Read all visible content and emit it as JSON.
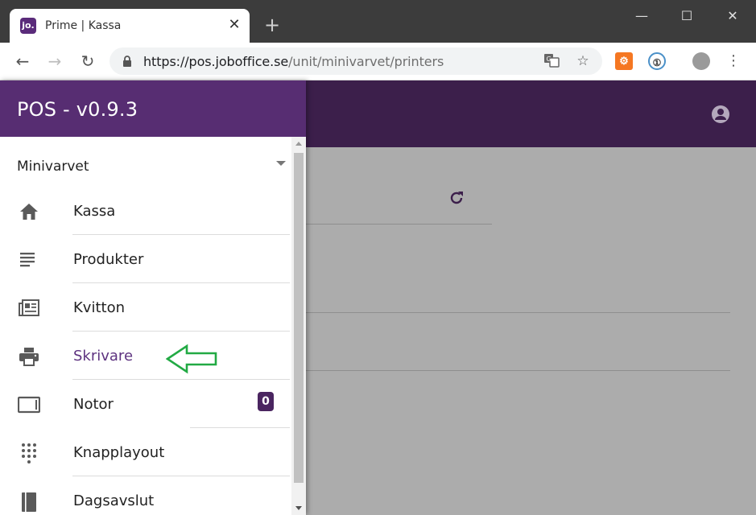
{
  "browser": {
    "tab_title": "Prime | Kassa",
    "favicon_text": "jo.",
    "url_host": "https://pos.joboffice.se",
    "url_path": "/unit/minivarvet/printers",
    "window_controls": [
      "minimize-icon",
      "maximize-icon",
      "close-icon"
    ]
  },
  "app": {
    "title": "POS - v0.9.3",
    "header_color": "#3c1f4b",
    "drawer_header_color": "#572d72",
    "accent": "#5e3380"
  },
  "drawer": {
    "unit": "Minivarvet",
    "items": [
      {
        "label": "Kassa",
        "icon": "home-icon",
        "active": false
      },
      {
        "label": "Produkter",
        "icon": "list-icon",
        "active": false
      },
      {
        "label": "Kvitton",
        "icon": "newspaper-icon",
        "active": false
      },
      {
        "label": "Skrivare",
        "icon": "printer-icon",
        "active": true
      },
      {
        "label": "Notor",
        "icon": "tablet-icon",
        "active": false,
        "badge": "0"
      },
      {
        "label": "Knapplayout",
        "icon": "dialpad-icon",
        "active": false
      },
      {
        "label": "Dagsavslut",
        "icon": "book-icon",
        "active": false
      }
    ]
  },
  "annotation": {
    "color": "#22aa44",
    "icon": "arrow-left-icon"
  }
}
